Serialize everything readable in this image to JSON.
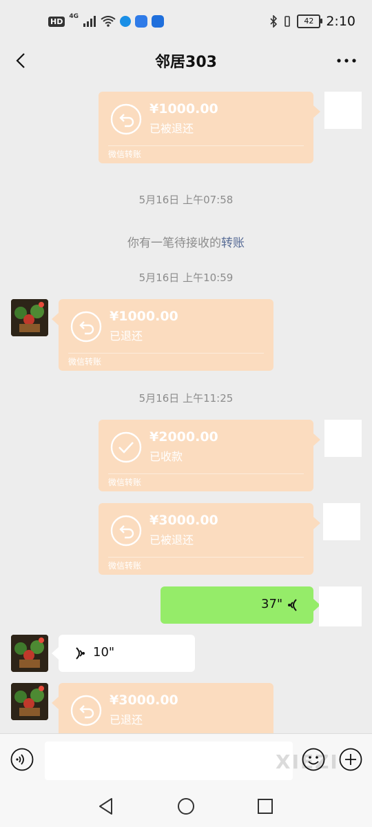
{
  "status_bar": {
    "hd": "HD",
    "network": "4G",
    "battery": "42",
    "time": "2:10"
  },
  "header": {
    "title": "邻居303"
  },
  "messages": {
    "m1": {
      "amount": "¥1000.00",
      "status": "已被退还",
      "footer": "微信转账"
    },
    "ts1": "5月16日 上午07:58",
    "sys": {
      "text": "你有一笔待接收的",
      "link": "转账"
    },
    "ts2": "5月16日 上午10:59",
    "m2": {
      "amount": "¥1000.00",
      "status": "已退还",
      "footer": "微信转账"
    },
    "ts3": "5月16日 上午11:25",
    "m3": {
      "amount": "¥2000.00",
      "status": "已收款",
      "footer": "微信转账"
    },
    "m4": {
      "amount": "¥3000.00",
      "status": "已被退还",
      "footer": "微信转账"
    },
    "v1": {
      "duration": "37\""
    },
    "v2": {
      "duration": "10\""
    },
    "m5": {
      "amount": "¥3000.00",
      "status": "已退还"
    }
  },
  "input_bar": {
    "placeholder": "",
    "watermark": "XIEZI"
  },
  "colors": {
    "transfer": "#fbdcbf",
    "sent_bubble": "#95ec69",
    "link": "#576b95",
    "background": "#ededed"
  },
  "icons": [
    "back-icon",
    "more-icon",
    "return-icon",
    "check-icon",
    "voice-icon",
    "emoji-icon",
    "plus-icon",
    "nav-back-icon",
    "nav-home-icon",
    "nav-recent-icon"
  ]
}
